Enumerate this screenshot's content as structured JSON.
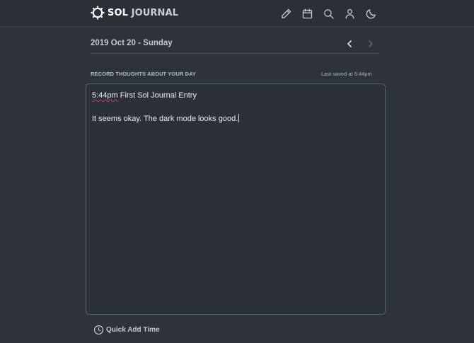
{
  "brand": {
    "name_part1": "SOL",
    "name_part2": "JOURNAL"
  },
  "nav": {
    "icons": [
      "pencil-icon",
      "calendar-icon",
      "search-icon",
      "user-icon",
      "moon-icon"
    ]
  },
  "date_bar": {
    "date": "2019 Oct 20 - Sunday"
  },
  "entry": {
    "section_label": "RECORD THOUGHTS ABOUT YOUR DAY",
    "saved_status": "Last saved at 5:44pm",
    "line1_time": "5:44pm",
    "line1_text": " First Sol Journal Entry",
    "line2_text": "It seems okay. The dark mode looks good."
  },
  "footer": {
    "quick_add_label": "Quick Add Time"
  },
  "colors": {
    "background": "#2d323b",
    "topbar": "#2a2f38",
    "text": "#e6e8ec",
    "spellcheck": "#d63838"
  }
}
